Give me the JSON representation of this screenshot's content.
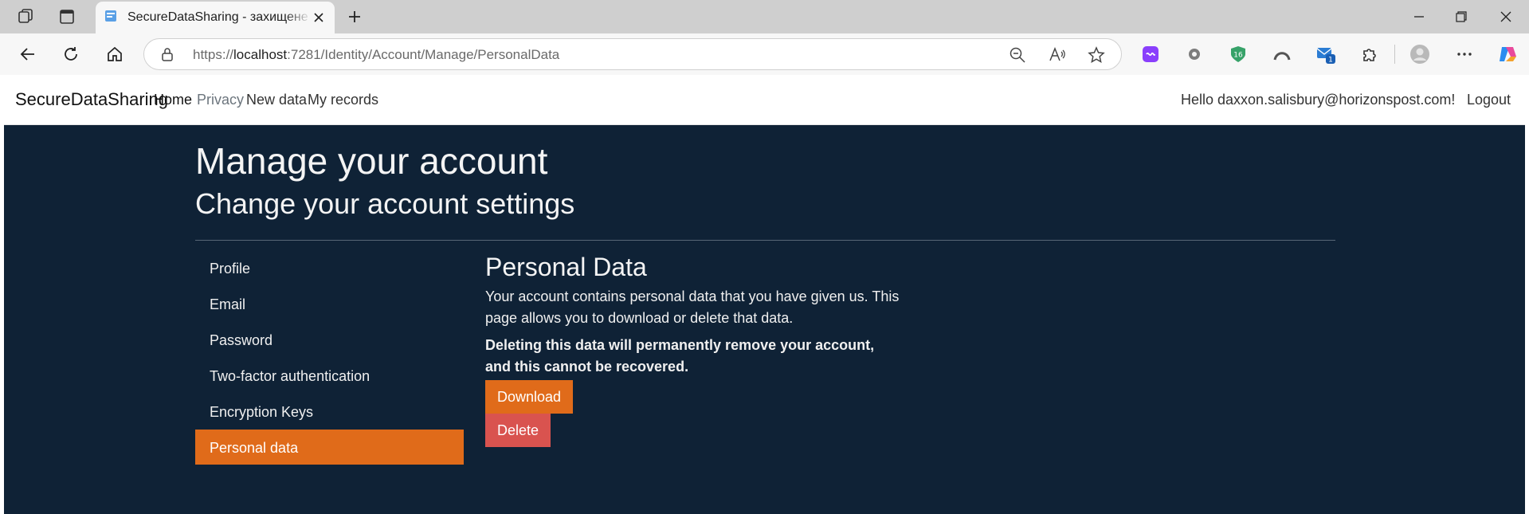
{
  "browser": {
    "tab_title": "SecureDataSharing - захищене сховище",
    "url_prefix": "https://",
    "url_host": "localhost",
    "url_rest": ":7281/Identity/Account/Manage/PersonalData",
    "ext_badge_green": "16",
    "ext_badge_mail": "1"
  },
  "navbar": {
    "brand": "SecureDataSharing",
    "links": [
      {
        "label": "Home"
      },
      {
        "label": "Privacy"
      },
      {
        "label": "New data"
      },
      {
        "label": "My records"
      }
    ],
    "hello": "Hello daxxon.salisbury@horizonspost.com!",
    "logout": "Logout"
  },
  "page": {
    "title": "Manage your account",
    "subtitle": "Change your account settings"
  },
  "sidebar": {
    "items": [
      {
        "label": "Profile"
      },
      {
        "label": "Email"
      },
      {
        "label": "Password"
      },
      {
        "label": "Two-factor authentication"
      },
      {
        "label": "Encryption Keys"
      },
      {
        "label": "Personal data"
      }
    ]
  },
  "section": {
    "title": "Personal Data",
    "description": "Your account contains personal data that you have given us. This page allows you to download or delete that data.",
    "warning": "Deleting this data will permanently remove your account, and this cannot be recovered.",
    "download_label": "Download",
    "delete_label": "Delete"
  },
  "colors": {
    "content_bg": "#0f2236",
    "accent_orange": "#e06b1a",
    "danger_red": "#d9534f"
  }
}
